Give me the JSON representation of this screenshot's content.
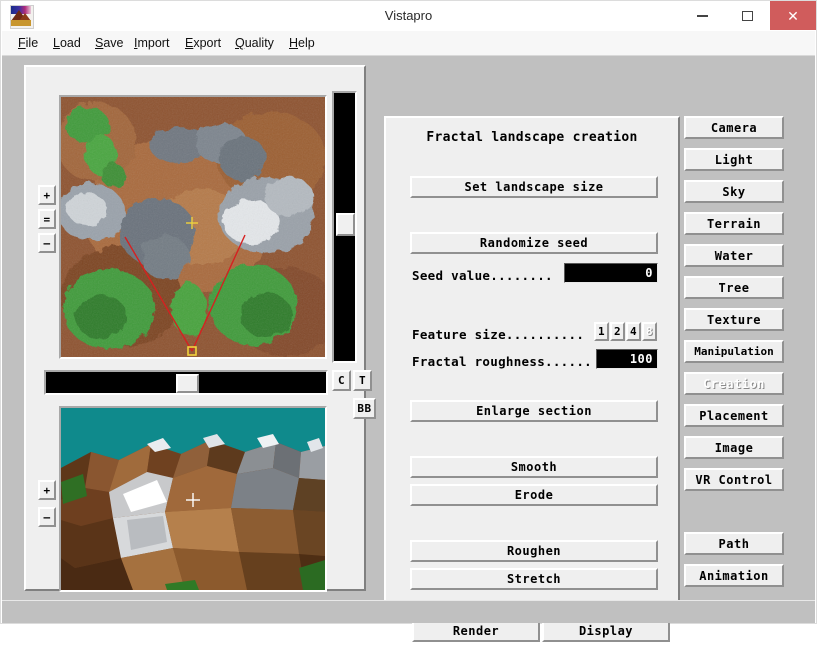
{
  "window": {
    "title": "Vistapro",
    "app_icon": "landscape-icon",
    "controls": {
      "minimize": "minimize-icon",
      "maximize": "maximize-icon",
      "close": "close-icon"
    }
  },
  "menu": {
    "items": [
      {
        "label": "File",
        "mnemonic": "F",
        "rest": "ile"
      },
      {
        "label": "Load",
        "mnemonic": "L",
        "rest": "oad"
      },
      {
        "label": "Save",
        "mnemonic": "S",
        "rest": "ave"
      },
      {
        "label": "Import",
        "mnemonic": "I",
        "rest": "mport"
      },
      {
        "label": "Export",
        "mnemonic": "E",
        "rest": "xport"
      },
      {
        "label": "Quality",
        "mnemonic": "Q",
        "rest": "uality"
      },
      {
        "label": "Help",
        "mnemonic": "H",
        "rest": "elp"
      }
    ]
  },
  "left_pane": {
    "map_view": {
      "name": "overhead-terrain-map",
      "crosshair": "+",
      "camera_marker": "camera-position-marker"
    },
    "map_zoom_buttons": [
      {
        "label": "+",
        "name": "map-zoom-in"
      },
      {
        "label": "=",
        "name": "map-zoom-reset"
      },
      {
        "label": "–",
        "name": "map-zoom-out"
      }
    ],
    "vertical_scrollbar": {
      "name": "map-vertical-scrollbar",
      "position_pct": 50
    },
    "horizontal_scrollbar": {
      "name": "map-horizontal-scrollbar",
      "position_pct": 50
    },
    "side_buttons": [
      {
        "label": "C",
        "name": "color-button"
      },
      {
        "label": "T",
        "name": "texture-button"
      },
      {
        "label": "BB",
        "name": "bb-button"
      }
    ],
    "preview_view": {
      "name": "3d-preview-view",
      "crosshair": "+"
    },
    "preview_zoom_buttons": [
      {
        "label": "+",
        "name": "preview-zoom-in"
      },
      {
        "label": "–",
        "name": "preview-zoom-out"
      }
    ]
  },
  "center_pane": {
    "heading": "Fractal landscape creation",
    "set_landscape_size": "Set landscape size",
    "randomize_seed": "Randomize seed",
    "seed_label": "Seed value........",
    "seed_value": "0",
    "feature_size_label": "Feature size..........",
    "feature_size_options": [
      {
        "label": "1",
        "selected": false,
        "disabled": false
      },
      {
        "label": "2",
        "selected": false,
        "disabled": false
      },
      {
        "label": "4",
        "selected": true,
        "disabled": false
      },
      {
        "label": "8",
        "selected": false,
        "disabled": true
      }
    ],
    "roughness_label": "Fractal roughness......",
    "roughness_value": "100",
    "enlarge_section": "Enlarge section",
    "smooth": "Smooth",
    "erode": "Erode",
    "roughen": "Roughen",
    "stretch": "Stretch"
  },
  "bottom_bar": {
    "render": "Render",
    "display": "Display"
  },
  "right_pane": {
    "buttons": [
      {
        "label": "Camera",
        "name": "camera",
        "active": false
      },
      {
        "label": "Light",
        "name": "light",
        "active": false
      },
      {
        "label": "Sky",
        "name": "sky",
        "active": false
      },
      {
        "label": "Terrain",
        "name": "terrain",
        "active": false
      },
      {
        "label": "Water",
        "name": "water",
        "active": false
      },
      {
        "label": "Tree",
        "name": "tree",
        "active": false
      },
      {
        "label": "Texture",
        "name": "texture",
        "active": false
      },
      {
        "label": "Manipulation",
        "name": "manipulation",
        "active": false
      },
      {
        "label": "Creation",
        "name": "creation",
        "active": true
      },
      {
        "label": "Placement",
        "name": "placement",
        "active": false
      },
      {
        "label": "Image",
        "name": "image",
        "active": false
      },
      {
        "label": "VR Control",
        "name": "vr-control",
        "active": false
      },
      {
        "label": "Path",
        "name": "path",
        "active": false
      },
      {
        "label": "Animation",
        "name": "animation",
        "active": false
      }
    ]
  },
  "colors": {
    "window_chrome": "#c0c0c0",
    "panel_face": "#efefef",
    "close_button": "#d05c5c",
    "field_background": "#000000",
    "preview_sky": "#0f8a8c",
    "map_terrain_brown": "#9a5c33",
    "map_vegetation_green": "#3f9b3a",
    "map_rock_grey": "#9aa0a8",
    "camera_line": "#d62020"
  }
}
